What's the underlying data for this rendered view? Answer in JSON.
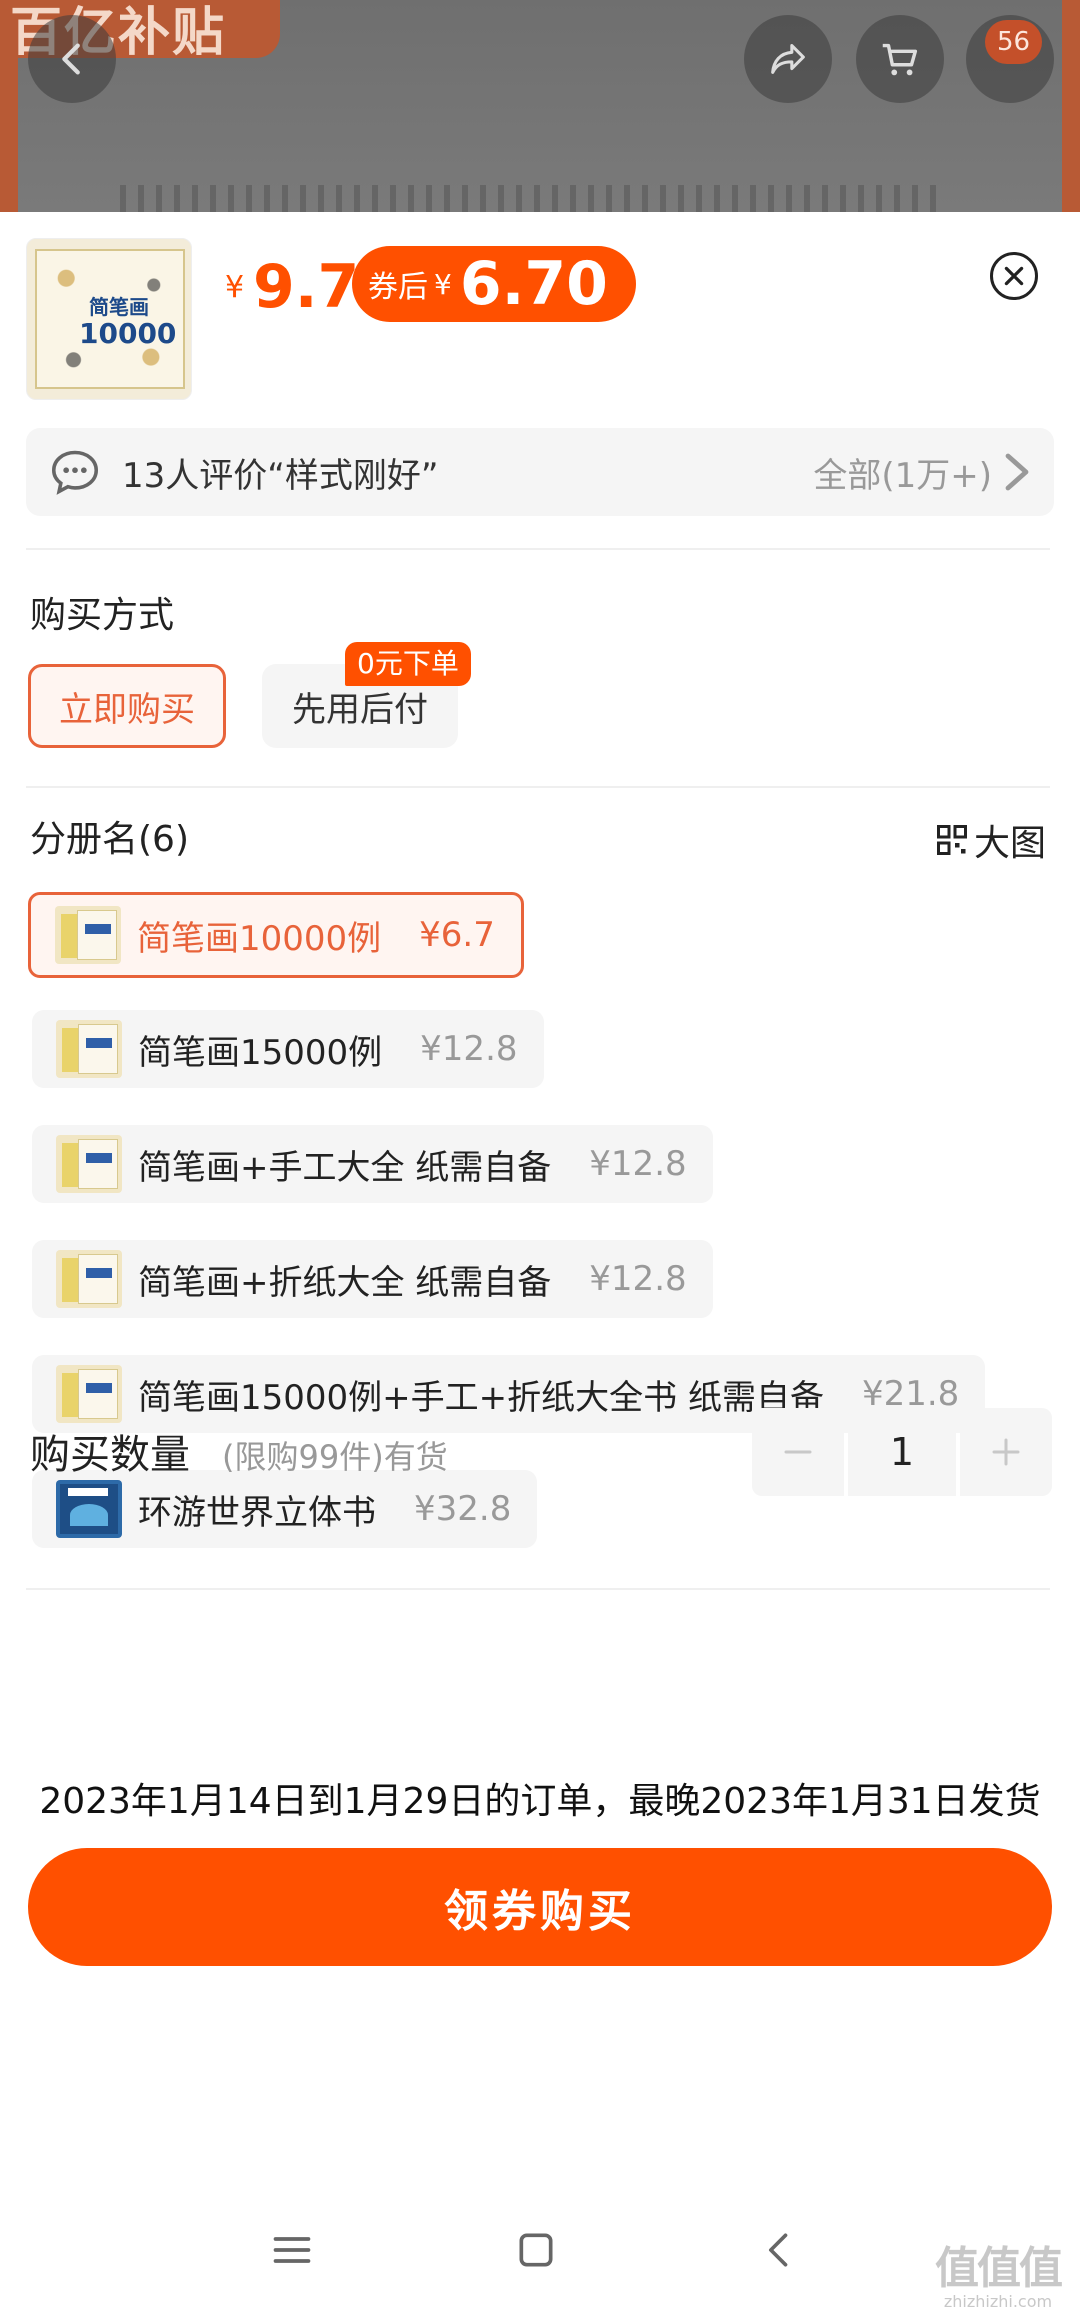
{
  "header": {
    "brand_text": "百亿补贴",
    "cart_badge": "56",
    "icons": [
      "back-icon",
      "share-icon",
      "cart-icon"
    ]
  },
  "sheet": {
    "price_currency": "¥",
    "price": "9.7",
    "coupon_label": "券后",
    "coupon_currency": "¥",
    "coupon_price": "6.70",
    "thumb_title_1": "简笔画",
    "thumb_title_2": "10000"
  },
  "review": {
    "text": "13人评价“样式刚好”",
    "all_label": "全部(1万+)"
  },
  "purchase_method": {
    "title": "购买方式",
    "buy_now": "立即购买",
    "pay_later": "先用后付",
    "pay_later_badge": "0元下单"
  },
  "volumes": {
    "title": "分册名(6)",
    "big_image_label": "大图",
    "options": [
      {
        "name": "简笔画10000例",
        "price": "¥6.7",
        "selected": true
      },
      {
        "name": "简笔画15000例",
        "price": "¥12.8",
        "selected": false
      },
      {
        "name": "简笔画+手工大全 纸需自备",
        "price": "¥12.8",
        "selected": false
      },
      {
        "name": "简笔画+折纸大全 纸需自备",
        "price": "¥12.8",
        "selected": false
      },
      {
        "name": "简笔画15000例+手工+折纸大全书 纸需自备",
        "price": "¥21.8",
        "selected": false
      },
      {
        "name": "环游世界立体书",
        "price": "¥32.8",
        "selected": false
      }
    ]
  },
  "quantity": {
    "title": "购买数量",
    "hint": "(限购99件)有货",
    "value": "1"
  },
  "delivery_note": "2023年1月14日到1月29日的订单，最晚2023年1月31日发货",
  "cta_label": "领券购买",
  "watermark": {
    "line1": "值值值",
    "line2": "zhizhizhi.com"
  },
  "colors": {
    "accent": "#ff5000",
    "selected_border": "#e8633a"
  }
}
